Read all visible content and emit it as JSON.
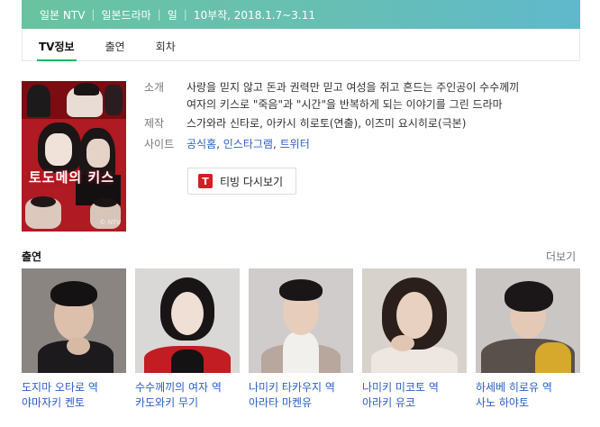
{
  "header": {
    "channel": "일본 NTV",
    "genre": "일본드라마",
    "day": "일",
    "detail": "10부작, 2018.1.7~3.11"
  },
  "tabs": [
    {
      "label": "TV정보",
      "active": true
    },
    {
      "label": "출연",
      "active": false
    },
    {
      "label": "회차",
      "active": false
    }
  ],
  "poster": {
    "title_text": "토도메의 키스",
    "credit": "© NTV"
  },
  "info": {
    "intro_label": "소개",
    "intro_line1": "사랑을 믿지 않고 돈과 권력만 믿고 여성을 쥐고 흔드는 주인공이 수수께끼",
    "intro_line2": "여자의 키스로 \"죽음\"과 \"시간\"을 반복하게 되는 이야기를 그린 드라마",
    "production_label": "제작",
    "production_value": "스가와라 신타로, 아카시 히로토(연출), 이즈미 요시히로(극본)",
    "site_label": "사이트",
    "site_links": [
      "공식홈",
      "인스타그램",
      "트위터"
    ],
    "site_separator": ", "
  },
  "tving_button": {
    "icon": "T",
    "label": "티빙 다시보기"
  },
  "cast_section": {
    "title": "출연",
    "more": "더보기"
  },
  "cast": [
    {
      "role": "도지마 오타로 역",
      "actor": "야마자키 켄토"
    },
    {
      "role": "수수께끼의 여자 역",
      "actor": "카도와키 무기"
    },
    {
      "role": "나미키 타카우지 역",
      "actor": "아라타 마켄유"
    },
    {
      "role": "나미키 미코토 역",
      "actor": "아라키 유코"
    },
    {
      "role": "하세베 히로유 역",
      "actor": "사노 하야토"
    }
  ],
  "colors": {
    "accent_green": "#00bb5d",
    "link_blue": "#2a5ec7",
    "header_start": "#69c3a0",
    "header_end": "#5fb9cb"
  }
}
